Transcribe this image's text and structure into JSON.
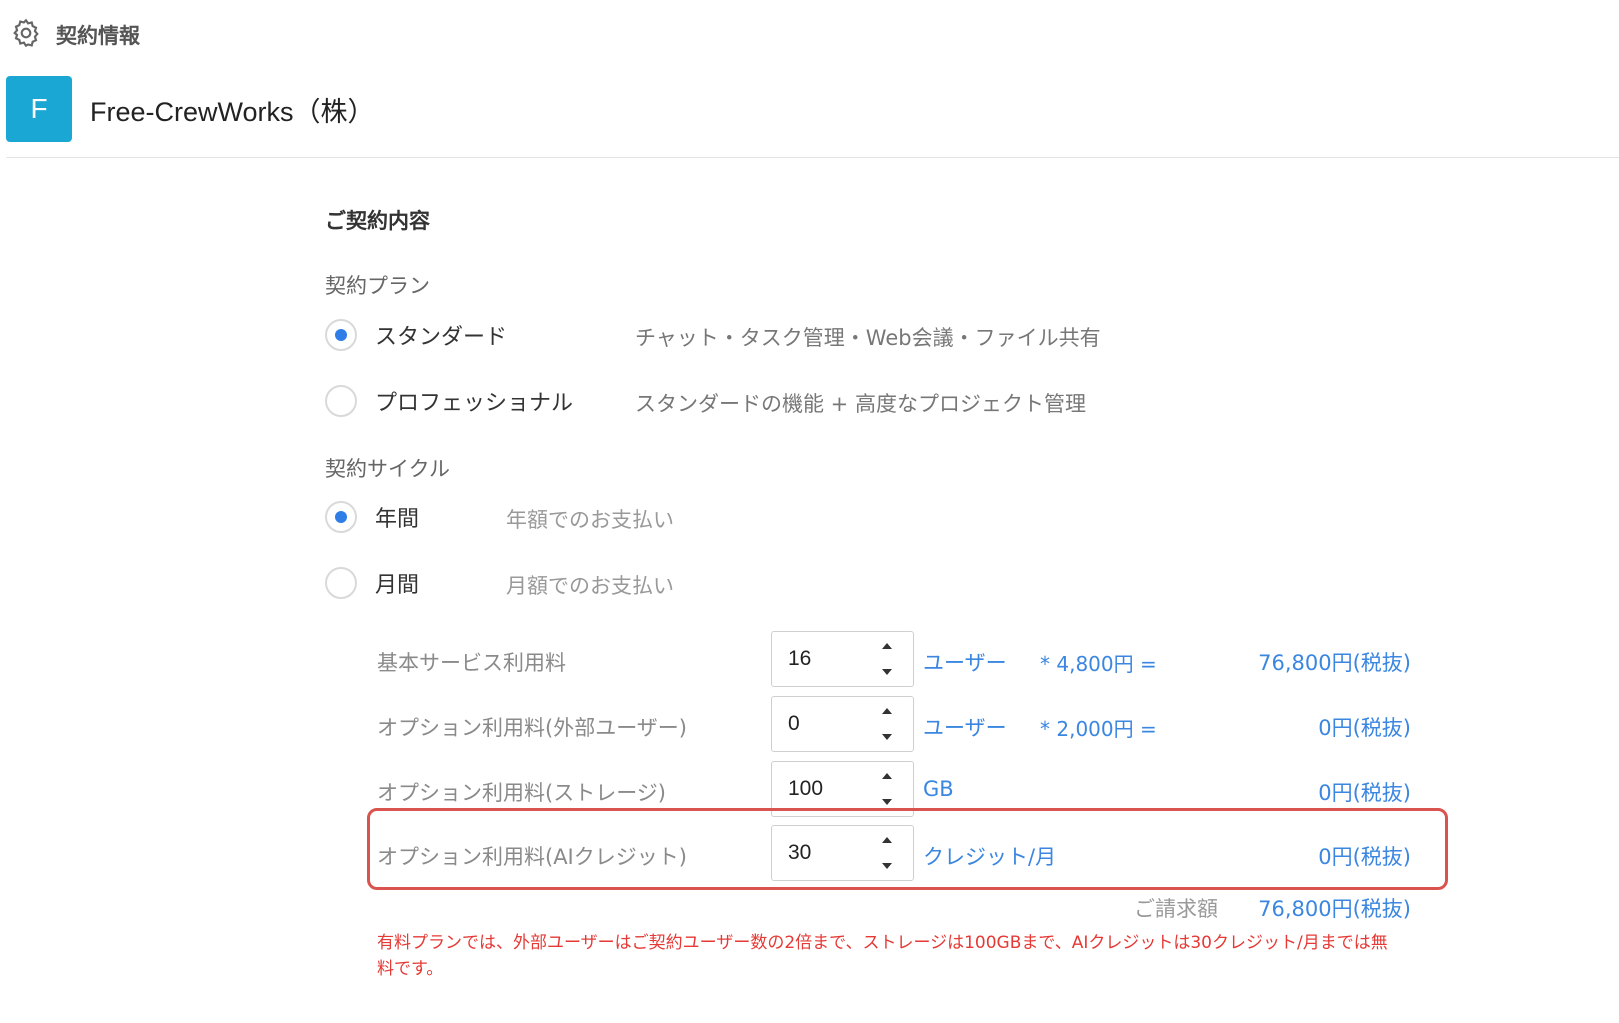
{
  "header": {
    "title": "契約情報",
    "icon": "gear-icon"
  },
  "company": {
    "initial": "F",
    "name": "Free-CrewWorks（株）",
    "avatar_color": "#1aa7d4"
  },
  "contract": {
    "section_title": "ご契約内容",
    "plan_label": "契約プラン",
    "plans": [
      {
        "label": "スタンダード",
        "desc": "チャット・タスク管理・Web会議・ファイル共有",
        "checked": true
      },
      {
        "label": "プロフェッショナル",
        "desc": "スタンダードの機能 + 高度なプロジェクト管理",
        "checked": false
      }
    ],
    "cycle_label": "契約サイクル",
    "cycles": [
      {
        "label": "年間",
        "desc": "年額でのお支払い",
        "checked": true
      },
      {
        "label": "月間",
        "desc": "月額でのお支払い",
        "checked": false
      }
    ]
  },
  "fees": [
    {
      "label": "基本サービス利用料",
      "value": "16",
      "unit": "ユーザー",
      "price": "* 4,800円 =",
      "amount": "76,800円(税抜)"
    },
    {
      "label": "オプション利用料(外部ユーザー)",
      "value": "0",
      "unit": "ユーザー",
      "price": "* 2,000円 =",
      "amount": "0円(税抜)"
    },
    {
      "label": "オプション利用料(ストレージ)",
      "value": "100",
      "unit": "GB",
      "price": "",
      "amount": "0円(税抜)"
    },
    {
      "label": "オプション利用料(AIクレジット)",
      "value": "30",
      "unit": "クレジット/月",
      "price": "",
      "amount": "0円(税抜)"
    }
  ],
  "billing": {
    "label": "ご請求額",
    "amount": "76,800円(税抜)"
  },
  "note": "有料プランでは、外部ユーザーはご契約ユーザー数の2倍まで、ストレージは100GBまで、AIクレジットは30クレジット/月までは無料です。",
  "colors": {
    "accent": "#3a86e0",
    "radio_checked": "#2f7ee8",
    "warning": "#e53935",
    "highlight_border": "#d9534f"
  }
}
